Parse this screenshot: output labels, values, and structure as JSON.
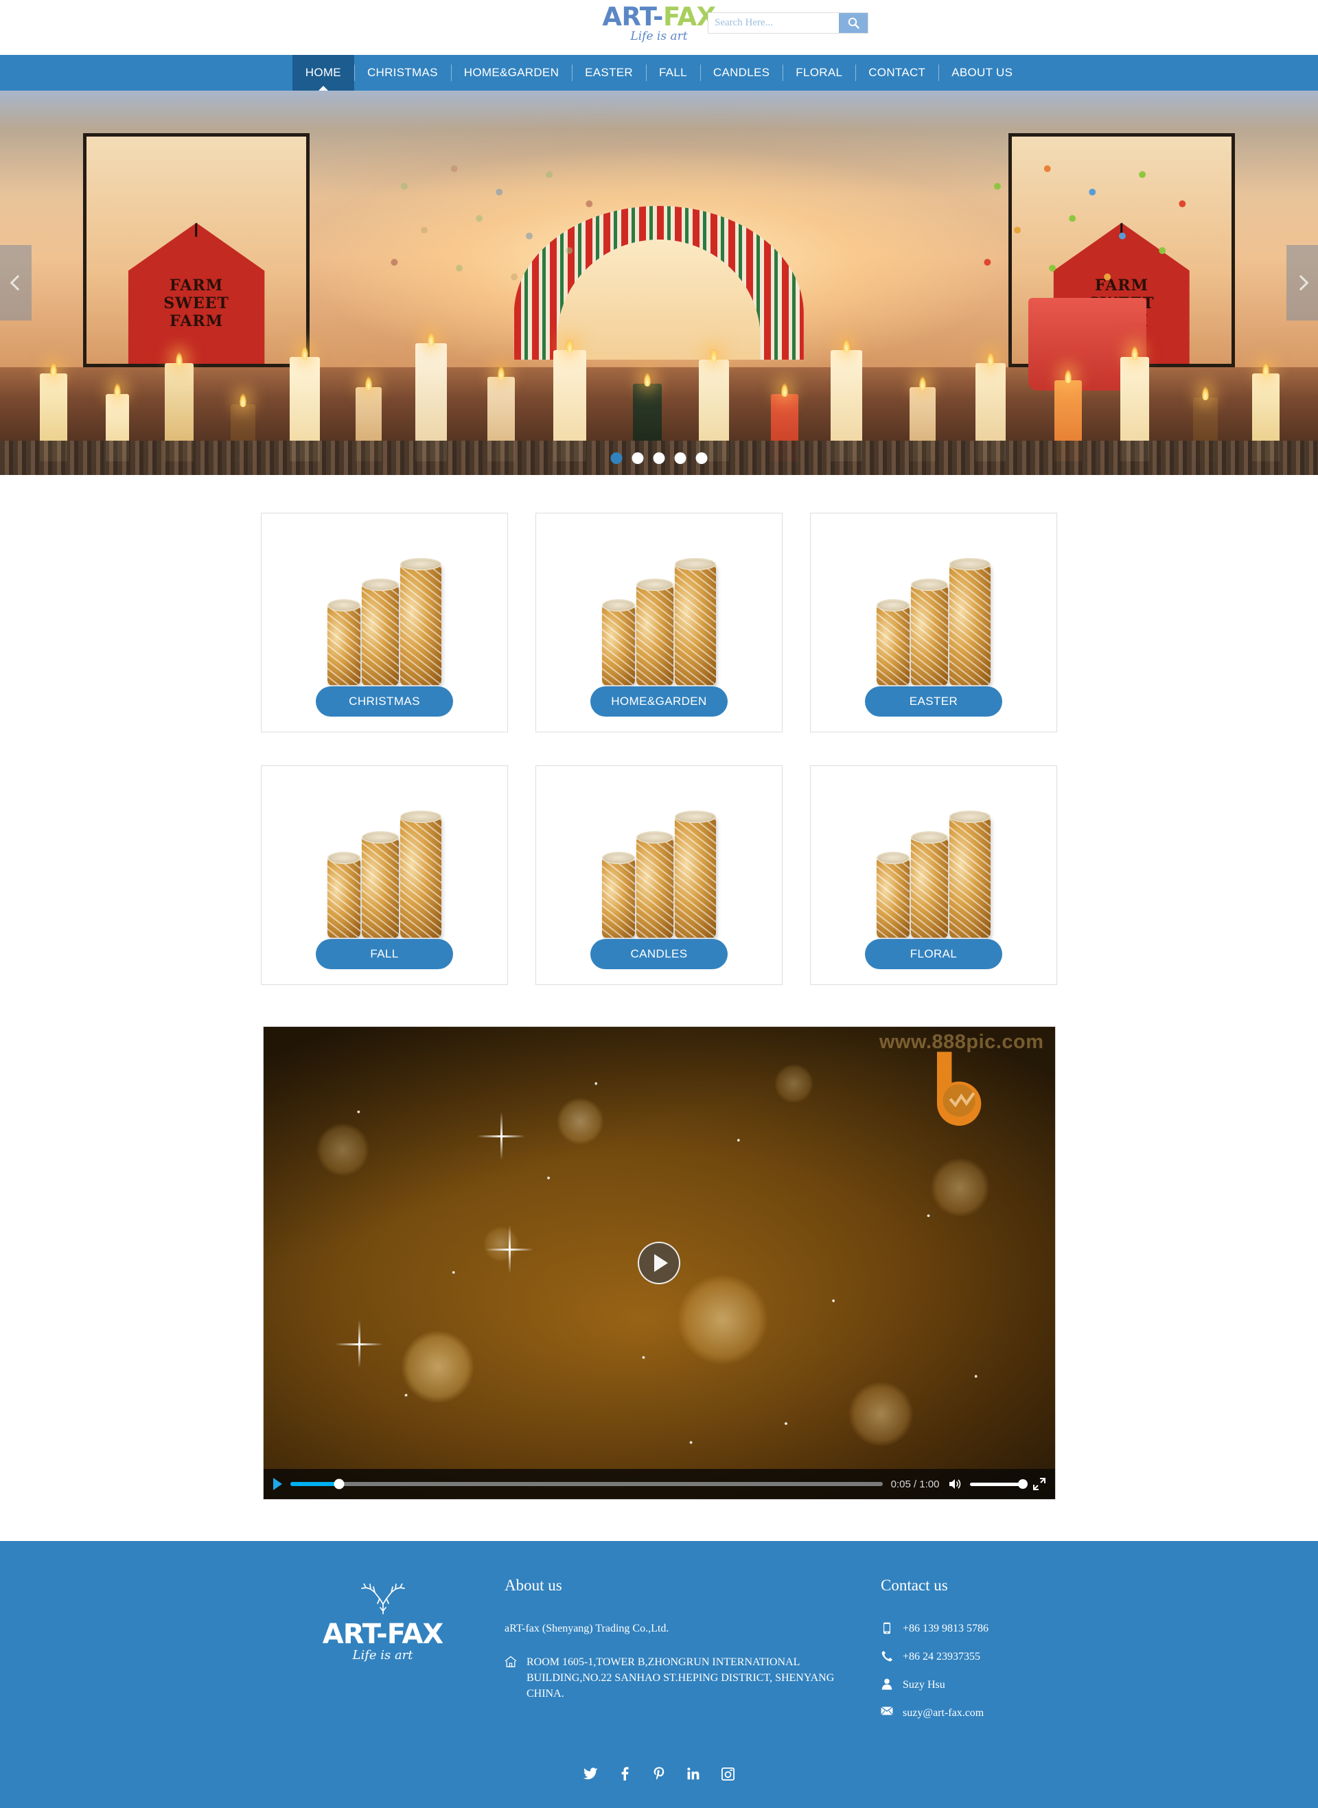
{
  "header": {
    "logo": {
      "part1": "ART-",
      "part2": "FAX",
      "tagline": "Life is art"
    },
    "search": {
      "placeholder": "Search Here...",
      "value": "",
      "icon": "search-icon"
    }
  },
  "nav": {
    "items": [
      {
        "label": "HOME",
        "active": true
      },
      {
        "label": "CHRISTMAS",
        "active": false
      },
      {
        "label": "HOME&GARDEN",
        "active": false
      },
      {
        "label": "EASTER",
        "active": false
      },
      {
        "label": "FALL",
        "active": false
      },
      {
        "label": "CANDLES",
        "active": false
      },
      {
        "label": "FLORAL",
        "active": false
      },
      {
        "label": "CONTACT",
        "active": false
      },
      {
        "label": "ABOUT US",
        "active": false
      }
    ]
  },
  "hero": {
    "prev_icon": "chevron-left-icon",
    "next_icon": "chevron-right-icon",
    "barn_text": "FARM\nSWEET\nFARM",
    "slides": 5,
    "active_slide": 1
  },
  "categories": [
    {
      "label": "CHRISTMAS"
    },
    {
      "label": "HOME&GARDEN"
    },
    {
      "label": "EASTER"
    },
    {
      "label": "FALL"
    },
    {
      "label": "CANDLES"
    },
    {
      "label": "FLORAL"
    }
  ],
  "video": {
    "watermark_text": "www.888pic.com",
    "play_overlay_icon": "play-circle-icon",
    "controls": {
      "play_icon": "play-icon",
      "current_time": "0:05",
      "duration": "1:00",
      "time_label": "0:05 / 1:00",
      "progress_percent": 8.3,
      "volume_icon": "volume-icon",
      "volume_percent": 100,
      "fullscreen_icon": "fullscreen-icon"
    }
  },
  "footer": {
    "logo": {
      "text": "ART-FAX",
      "tagline": "Life is art",
      "icon": "deer-icon"
    },
    "about": {
      "heading": "About us",
      "company": "aRT-fax (Shenyang) Trading Co.,Ltd.",
      "address_icon": "home-icon",
      "address": "ROOM 1605-1,TOWER B,ZHONGRUN INTERNATIONAL BUILDING,NO.22 SANHAO ST.HEPING DISTRICT, SHENYANG CHINA."
    },
    "contact": {
      "heading": "Contact us",
      "rows": [
        {
          "icon": "mobile-icon",
          "text": "+86 139 9813 5786"
        },
        {
          "icon": "phone-icon",
          "text": "+86 24 23937355"
        },
        {
          "icon": "user-icon",
          "text": "Suzy Hsu"
        },
        {
          "icon": "mail-icon",
          "text": "suzy@art-fax.com"
        }
      ]
    },
    "social": [
      {
        "name": "twitter-icon",
        "glyph": "𝕏"
      },
      {
        "name": "facebook-icon",
        "glyph": "f"
      },
      {
        "name": "pinterest-icon",
        "glyph": "P"
      },
      {
        "name": "linkedin-icon",
        "glyph": "in"
      },
      {
        "name": "instagram-icon",
        "glyph": "▣"
      }
    ]
  },
  "colors": {
    "brand_blue": "#3282bf",
    "brand_green": "#a8cf5d",
    "logo_blue": "#5b87c5",
    "nav_active": "#1d5c8f",
    "search_btn": "#85b0dd",
    "progress": "#00b0f0"
  }
}
